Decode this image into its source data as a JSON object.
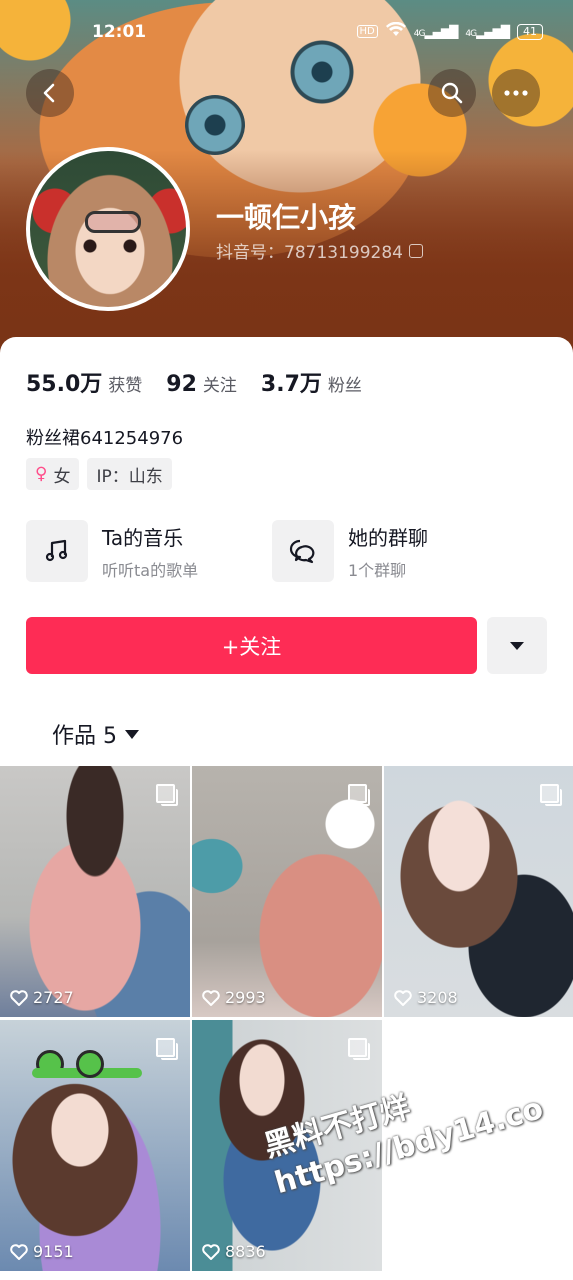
{
  "status_bar": {
    "time": "12:01",
    "hd": "HD",
    "net1": "4G",
    "net2": "4G",
    "battery": "41"
  },
  "profile": {
    "nickname": "一顿仨小孩",
    "douyin_id": "抖音号：78713199284"
  },
  "stats": [
    {
      "value": "55.0万",
      "label": "获赞"
    },
    {
      "value": "92",
      "label": "关注"
    },
    {
      "value": "3.7万",
      "label": "粉丝"
    }
  ],
  "fan_group": "粉丝裙641254976",
  "tags": {
    "gender": "女",
    "gender_icon": "♀",
    "ip": "IP：山东"
  },
  "services": [
    {
      "title": "Ta的音乐",
      "subtitle": "听听ta的歌单",
      "icon": "music-note-icon"
    },
    {
      "title": "她的群聊",
      "subtitle": "1个群聊",
      "icon": "chat-bubbles-icon"
    }
  ],
  "follow_button": "+关注",
  "works_tab": {
    "label": "作品 5"
  },
  "posts": [
    {
      "likes": "2727"
    },
    {
      "likes": "2993"
    },
    {
      "likes": "3208"
    },
    {
      "likes": "9151"
    },
    {
      "likes": "8836"
    }
  ],
  "watermark": {
    "line1": "黑料不打烊",
    "line2": "https://bdy14.co"
  },
  "colors": {
    "follow": "#fe2c55",
    "tag_bg": "#f1f1f2",
    "text_primary": "#161823",
    "text_secondary": "#8a8b91"
  }
}
